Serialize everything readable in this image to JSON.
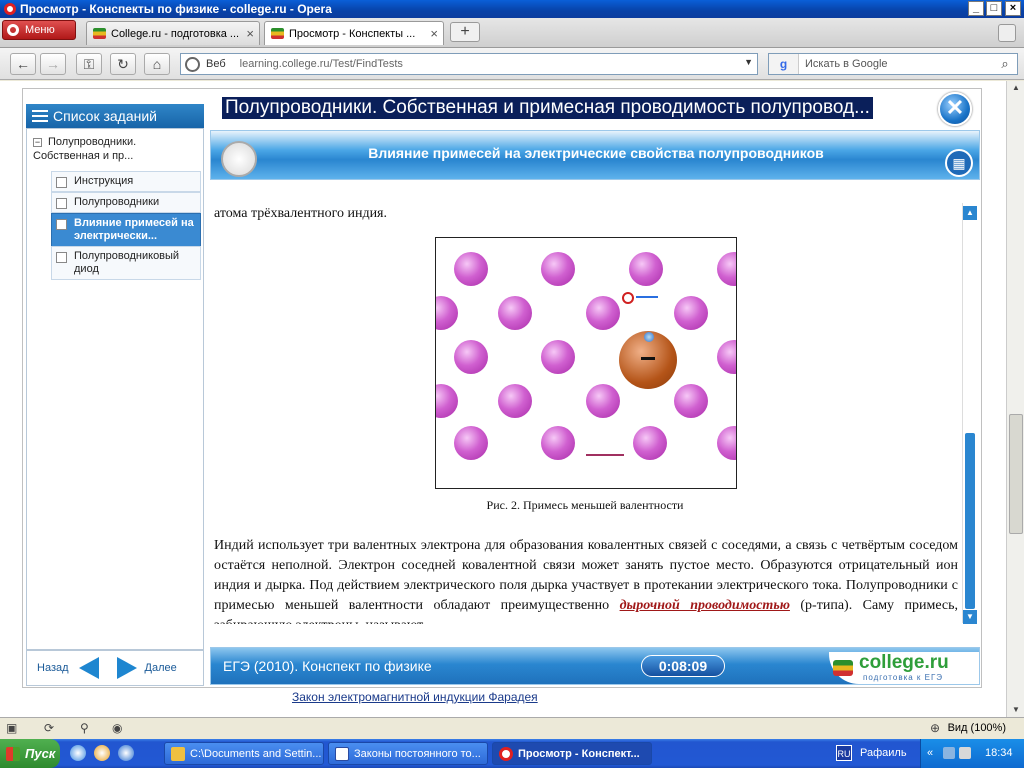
{
  "window": {
    "title": "Просмотр - Конспекты по физике - college.ru - Opera",
    "btn_min": "_",
    "btn_max": "□",
    "btn_close": "×"
  },
  "tabs": {
    "menu_label": "Меню",
    "items": [
      {
        "label": "College.ru - подготовка ..."
      },
      {
        "label": "Просмотр - Конспекты ..."
      }
    ],
    "new_tab": "+",
    "close_glyph": "×"
  },
  "address": {
    "web_label": "Веб",
    "url": "learning.college.ru/Test/FindTests",
    "search_engine_glyph": "g",
    "search_placeholder": "Искать в Google"
  },
  "app": {
    "title": "Полупроводники. Собственная и примесная проводимость полупровод...",
    "close_glyph": "✕",
    "sidebar_title": "Список заданий",
    "tree_root": "Полупроводники. Собственная и пр...",
    "tree_items": [
      {
        "label": "Инструкция"
      },
      {
        "label": "Полупроводники"
      },
      {
        "label": "Влияние примесей на электрически..."
      },
      {
        "label": "Полупроводниковый диод"
      }
    ],
    "nav_back": "Назад",
    "nav_forward": "Далее",
    "section_title": "Влияние примесей на электрические свойства полупроводников",
    "text_top": "атома трёхвалентного индия.",
    "figure_caption": "Рис. 2. Примесь меньшей валентности",
    "body_text_part1": "Индий использует три валентных электрона для образования ковалентных связей с соседями, а связь с четвёртым соседом остаётся неполной. Электрон соседней ковалентной связи может занять пустое место. Образуются отрицательный ион индия и дырка. Под действием электрического поля дырка участвует в протекании электрического тока. Полупроводники с примесью меньшей валентности обладают преимущественно ",
    "body_text_em": "дырочной проводимостью",
    "body_text_part2": " (p-типа). Саму примесь, забирающую электроны, называют",
    "footer_left": "ЕГЭ (2010). Конспект по физике",
    "timer": "0:08:09",
    "logo_brand": "college.ru",
    "logo_sub": "подготовка к ЕГЭ"
  },
  "below_link": "Закон электромагнитной индукции Фарадея",
  "status": {
    "zoom": "Вид (100%)"
  },
  "taskbar": {
    "start": "Пуск",
    "buttons": [
      {
        "label": "C:\\Documents and Settin..."
      },
      {
        "label": "Законы постоянного то..."
      },
      {
        "label": "Просмотр - Конспект..."
      }
    ],
    "lang": "RU",
    "user": "Рафаиль",
    "time": "18:34"
  },
  "colors": {
    "accent": "#2a86d0",
    "title_bg": "#0a1f5a",
    "atom": "#d060d0",
    "impurity": "#b45418"
  }
}
